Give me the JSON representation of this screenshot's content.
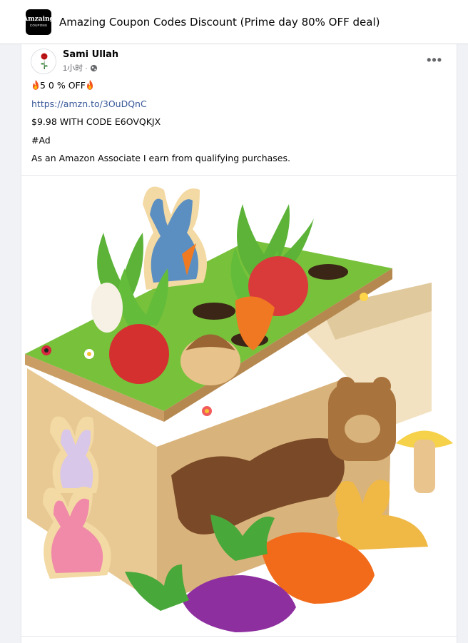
{
  "group": {
    "logo_line1": "Amzaing",
    "logo_line2": "COUPONS",
    "title": "Amazing Coupon Codes Discount (Prime day 80% OFF deal)"
  },
  "post": {
    "author": "Sami Ullah",
    "time": "1小时 ·",
    "more_label": "•••",
    "lines": {
      "offer": "5 0 % OFF",
      "link": "https://amzn.to/3OuDQnC",
      "code": "$9.98 WITH CODE E6OVQKJX",
      "tag": "#Ad",
      "disclosure": "As an Amazon Associate I earn from qualifying purchases."
    }
  },
  "colors": {
    "link": "#385898",
    "meta": "#65676b",
    "background": "#f0f2f5"
  },
  "icons": {
    "flame": "fire-emoji-icon",
    "globe": "globe-icon",
    "more": "more-options-icon"
  }
}
